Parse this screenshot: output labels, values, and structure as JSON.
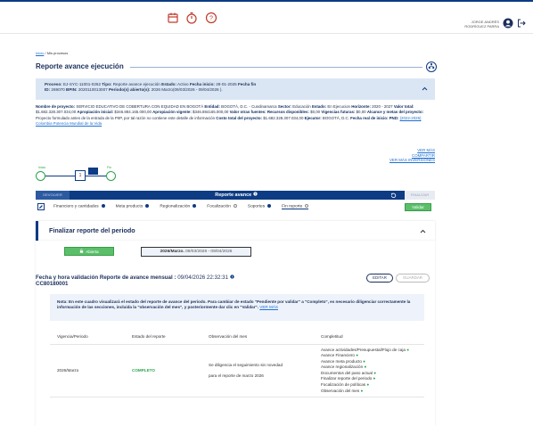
{
  "header": {
    "icons": [
      "calendar-icon",
      "timer-icon",
      "help-icon"
    ],
    "user_line1": "JORGE ANDRÉS",
    "user_line2": "RODRÍGUEZ PARRA"
  },
  "breadcrumb": {
    "home": "Inicio",
    "separator": "/",
    "current": "Mis procesos"
  },
  "page_title": "Reporte avance ejecución",
  "info": {
    "l1_process_label": "Proceso:",
    "l1_process": "EJ-SYC-11001-0262",
    "l1_type_label": "Tipo:",
    "l1_type": "Reporte avance ejecución",
    "l1_state_label": "Estado:",
    "l1_state": "Activo",
    "l1_start_label": "Fecha inicio:",
    "l1_start": "28-01-2025",
    "l1_end_label": "Fecha fin",
    "l2_id_label": "ID:",
    "l2_id": "269070",
    "l2_bpin_label": "BPIN:",
    "l2_bpin": "2020110013007",
    "l2_period_label": "Periodo(s) abierto(s):",
    "l2_period": "2026 Marzo(09/03/2026 - 09/04/2026 )."
  },
  "description": {
    "project_label": "Nombre de proyecto:",
    "project": "SERVICIO EDUCATIVO DE COBERTURA CON EQUIDAD EN BOGOTÁ",
    "entity_label": "Entidad:",
    "entity": "BOGOTÁ, D.C. - Cundinamarca",
    "sector_label": "Sector:",
    "sector": "Educación",
    "status_label": "Estado:",
    "status": "En Ejecucion",
    "horizon_label": "Horizonte:",
    "horizon": "2020 - 2027",
    "total_label": "Valor total:",
    "total": "$1.682.328.307.034,00",
    "initial_label": "Apropiación inicial:",
    "initial": "$346.884.165.000,00",
    "current_label": "Apropiación vigente:",
    "current": "$346.884165.000,00",
    "other_label": "Valor otras fuentes:",
    "available_label": "Recursos disponibles:",
    "available": "$0,00",
    "future_label": "Vigencias futuras:",
    "future": "$0,00",
    "scope_label": "Alcance y metas del proyecto:",
    "scope": "Proyecto formulado antes de la entrada de la PIIP, por tal razón no contiene este detalle de información",
    "cost_label": "Costo total del proyecto:",
    "cost": "$1.682.328.307.034,00",
    "executor_label": "Ejecutor:",
    "executor": "BOGOTÁ, D.C.",
    "real_start_label": "Fecha real de inicio:",
    "pnd_label": "PND:",
    "pnd": "(2022-2026) Colombia Potencia Mundial de la Vida",
    "more": "VER MÁS",
    "compare": "COMPARTIR",
    "more_inv": "VER MÁS INVERSIONES"
  },
  "stepper": {
    "start": "Inicio",
    "step": "1",
    "end": "Fin"
  },
  "nav": {
    "back": "DEVOLVER",
    "title": "Reporte avance",
    "finish": "FINALIZAR"
  },
  "tabs": [
    {
      "label": "Financiero y cantidades",
      "done": true
    },
    {
      "label": "Meta producto",
      "done": true
    },
    {
      "label": "Regionalización",
      "done": true
    },
    {
      "label": "Focalización",
      "done": false
    },
    {
      "label": "Soportes",
      "done": true
    },
    {
      "label": "Fin reporte",
      "done": false
    }
  ],
  "validate_label": "Validar",
  "finalize_section": {
    "title": "Finalizar reporte del periodo",
    "open_label": "Abierta",
    "period_strong": "2026/Marzo.",
    "period_range": "09/03/2026 - 09/04/2026",
    "validation_title": "Fecha y hora validación Reporte de avance mensual :",
    "validation_value": "09/04/2026 22:32:31",
    "validation_id": "CC80180001",
    "edit_label": "EDITAR",
    "save_label": "GUARDAR",
    "note_label": "Nota:",
    "note": "En este cuadro visualizará el estado del reporte de avance del periodo. Para cambiar de estado \"Pendiente por validar\" a \"Completo\", es necesario diligenciar correctamente la información de las secciones, incluida la \"observación del mes\", y posteriormente dar clic en \"Validar\".",
    "note_more": "VER MÁS"
  },
  "table": {
    "headers": [
      "Vigencia/Periodo",
      "Estado del reporte",
      "Observación del mes",
      "Completitud"
    ],
    "row": {
      "period": "2026/Marzo",
      "state": "COMPLETO",
      "observation_l1": "Se diligencia el seguimiento sin novedad",
      "observation_l2": "para el reporte de marzo 2026",
      "completeness": [
        "Avance actividades/Presupuestal/Flujo de caja",
        "Avance Financiero",
        "Avance meta producto",
        "Avance regionalización",
        "Documentos del paso actual",
        "Finalizar reporte del periodo",
        "Focalización de políticas",
        "Observación del mes"
      ]
    }
  },
  "colors": {
    "primary": "#0d3b84",
    "success": "#2aa44a",
    "info_bg": "#dbe6f4"
  }
}
